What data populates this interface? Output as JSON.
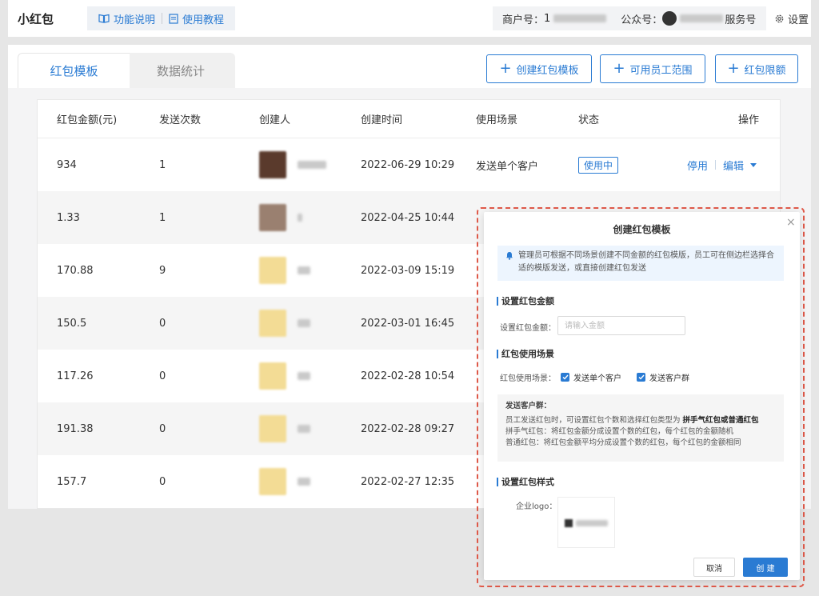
{
  "app_title": "小红包",
  "nav": {
    "feature_label": "功能说明",
    "tutorial_label": "使用教程"
  },
  "account": {
    "merchant_label": "商户号：",
    "merchant_value_prefix": "1",
    "official_label": "公众号：",
    "official_value_suffix": "服务号",
    "settings_label": "设置"
  },
  "tabs": [
    {
      "label": "红包模板",
      "active": true
    },
    {
      "label": "数据统计",
      "active": false
    }
  ],
  "actions": {
    "create_template": "创建红包模板",
    "staff_scope": "可用员工范围",
    "limit": "红包限额"
  },
  "table": {
    "headers": [
      "红包金额(元)",
      "发送次数",
      "创建人",
      "创建时间",
      "使用场景",
      "状态",
      "操作"
    ],
    "rows": [
      {
        "amount": "934",
        "count": "1",
        "avatar_color": "#5a3a2c",
        "time": "2022-06-29 10:29",
        "scene": "发送单个客户",
        "status": "使用中",
        "op_disable": "停用",
        "op_edit": "编辑"
      },
      {
        "amount": "1.33",
        "count": "1",
        "avatar_color": "#9a8070",
        "time": "2022-04-25 10:44"
      },
      {
        "amount": "170.88",
        "count": "9",
        "avatar_color": "#f3dc95",
        "time": "2022-03-09 15:19"
      },
      {
        "amount": "150.5",
        "count": "0",
        "avatar_color": "#f3dc95",
        "time": "2022-03-01 16:45"
      },
      {
        "amount": "117.26",
        "count": "0",
        "avatar_color": "#f3dc95",
        "time": "2022-02-28 10:54"
      },
      {
        "amount": "191.38",
        "count": "0",
        "avatar_color": "#f3dc95",
        "time": "2022-02-28 09:27"
      },
      {
        "amount": "157.7",
        "count": "0",
        "avatar_color": "#f3dc95",
        "time": "2022-02-27 12:35"
      }
    ]
  },
  "dialog": {
    "title": "创建红包模板",
    "notice": "管理员可根据不同场景创建不同金额的红包模版，员工可在侧边栏选择合适的模版发送，或直接创建红包发送",
    "section_amount": "设置红包金额",
    "amount_label": "设置红包金额：",
    "amount_placeholder": "请输入金额",
    "section_scene": "红包使用场景",
    "scene_label": "红包使用场景：",
    "scene_single": "发送单个客户",
    "scene_group": "发送客户群",
    "tip_title": "发送客户群：",
    "tip_line1_pre": "员工发送红包时，可设置红包个数和选择红包类型为 ",
    "tip_line1_strong": "拼手气红包或普通红包",
    "tip_line2": "拼手气红包：将红包金额分成设置个数的红包，每个红包的金额随机",
    "tip_line3": "普通红包：将红包金额平均分成设置个数的红包，每个红包的金额相同",
    "section_style": "设置红包样式",
    "logo_label": "企业logo：",
    "cancel": "取消",
    "create": "创 建"
  },
  "colors": {
    "accent": "#2a7bd3",
    "highlight_dash": "#e05a4a"
  }
}
